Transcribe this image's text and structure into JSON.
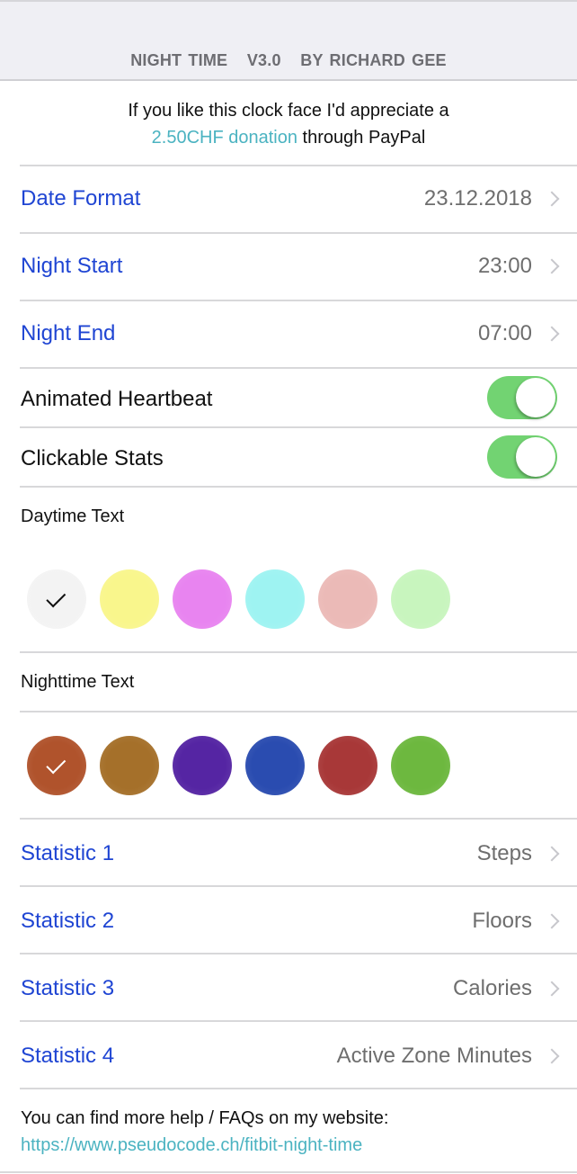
{
  "header": {
    "title": "NIGHT TIME   V3.0   BY RICHARD GEE"
  },
  "donation": {
    "text_before": "If you like this clock face I'd appreciate a",
    "link_text": "2.50CHF donation",
    "text_after": " through PayPal"
  },
  "settings": [
    {
      "label": "Date Format",
      "value": "23.12.2018"
    },
    {
      "label": "Night Start",
      "value": "23:00"
    },
    {
      "label": "Night End",
      "value": "07:00"
    }
  ],
  "toggles": [
    {
      "label": "Animated Heartbeat",
      "on": true
    },
    {
      "label": "Clickable Stats",
      "on": true
    }
  ],
  "daytime": {
    "label": "Daytime Text",
    "selected_index": 0,
    "colors": [
      "#f3f3f3",
      "#f9f68c",
      "#e884f0",
      "#9ef3f2",
      "#ebbab7",
      "#c8f5be"
    ],
    "check_color": "#111111"
  },
  "nighttime": {
    "label": "Nighttime Text",
    "selected_index": 0,
    "colors": [
      "#b0532c",
      "#a5702a",
      "#5525a3",
      "#2a4cb0",
      "#a83838",
      "#6db83f"
    ],
    "check_color": "#ffffff"
  },
  "statistics": [
    {
      "label": "Statistic 1",
      "value": "Steps"
    },
    {
      "label": "Statistic 2",
      "value": "Floors"
    },
    {
      "label": "Statistic 3",
      "value": "Calories"
    },
    {
      "label": "Statistic 4",
      "value": "Active Zone Minutes"
    }
  ],
  "footer": {
    "text": "You can find more help / FAQs on my website:",
    "link": "https://www.pseudocode.ch/fitbit-night-time"
  },
  "colors": {
    "accent_blue": "#1f45d3",
    "link_teal": "#4bb3c1",
    "toggle_green": "#72d372"
  }
}
